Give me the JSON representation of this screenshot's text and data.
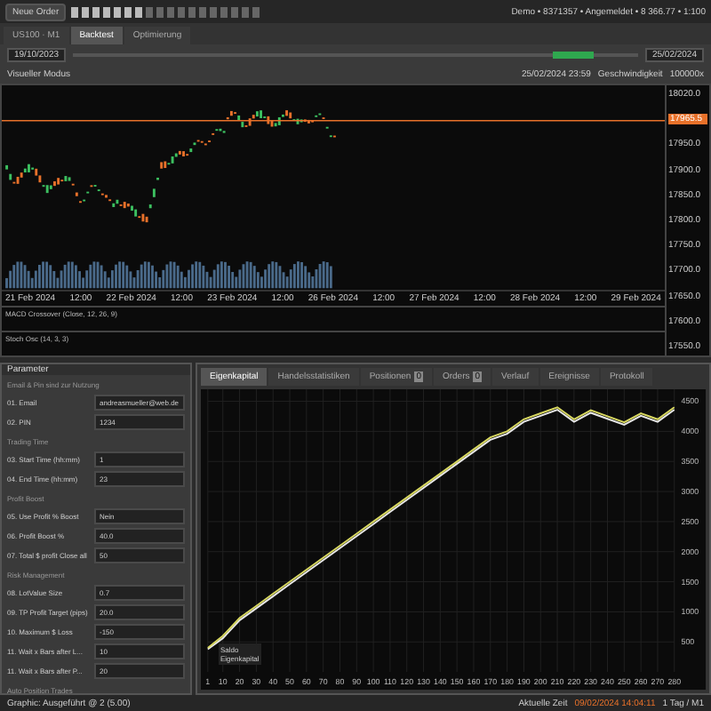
{
  "toolbar": {
    "new_order": "Neue Order",
    "account": "Demo • 8371357 • Angemeldet • 8 366.77 • 1:100"
  },
  "tabs": [
    {
      "label": "US100 · M1",
      "selected": false
    },
    {
      "label": "Backtest",
      "selected": true
    },
    {
      "label": "Optimierung",
      "selected": false
    }
  ],
  "range": {
    "start": "19/10/2023",
    "end": "25/02/2024",
    "level": 0.92
  },
  "visual_mode": {
    "label": "Visueller Modus",
    "time": "25/02/2024 23:59",
    "speed_label": "Geschwindigkeit",
    "speed": "100000x"
  },
  "chart": {
    "price_tag": "17965.5",
    "price_labels": [
      "18020.0",
      "17950.0",
      "17900.0",
      "17850.0",
      "17800.0",
      "17750.0",
      "17700.0",
      "17650.0",
      "17600.0",
      "17550.0"
    ],
    "time_labels": [
      "21 Feb 2024",
      "12:00",
      "22 Feb 2024",
      "12:00",
      "23 Feb 2024",
      "12:00",
      "26 Feb 2024",
      "12:00",
      "27 Feb 2024",
      "12:00",
      "28 Feb 2024",
      "12:00",
      "29 Feb 2024"
    ],
    "indicator_1": "MACD Crossover (Close, 12, 26, 9)",
    "indicator_2": "Stoch Osc (14, 3, 3)"
  },
  "parameters": {
    "title": "Parameter",
    "groups": [
      {
        "title": "Email & Pin sind zur Nutzung",
        "rows": [
          {
            "label": "01. Email",
            "value": "andreasmueller@web.de"
          },
          {
            "label": "02. PIN",
            "value": "1234"
          }
        ]
      },
      {
        "title": "Trading Time",
        "rows": [
          {
            "label": "03. Start Time (hh:mm)",
            "value": "1"
          },
          {
            "label": "04. End Time (hh:mm)",
            "value": "23"
          }
        ]
      },
      {
        "title": "Profit Boost",
        "rows": [
          {
            "label": "05. Use Profit % Boost",
            "value": "Nein"
          },
          {
            "label": "06. Profit Boost %",
            "value": "40.0"
          },
          {
            "label": "07. Total $ profit Close all",
            "value": "50"
          }
        ]
      },
      {
        "title": "Risk Management",
        "rows": [
          {
            "label": "08. LotValue Size",
            "value": "0.7"
          },
          {
            "label": "09. TP Profit Target (pips)",
            "value": "20.0"
          },
          {
            "label": "10. Maximum $ Loss",
            "value": "-150"
          },
          {
            "label": "11. Wait x Bars after L...",
            "value": "10"
          },
          {
            "label": "11. Wait x Bars after P...",
            "value": "20"
          }
        ]
      }
    ],
    "more": "Auto Position Trades"
  },
  "result_tabs": [
    {
      "label": "Eigenkapital",
      "selected": true
    },
    {
      "label": "Handelsstatistiken",
      "selected": false
    },
    {
      "label": "Positionen",
      "selected": false,
      "count": "0"
    },
    {
      "label": "Orders",
      "selected": false,
      "count": "0"
    },
    {
      "label": "Verlauf",
      "selected": false
    },
    {
      "label": "Ereignisse",
      "selected": false
    },
    {
      "label": "Protokoll",
      "selected": false
    }
  ],
  "equity": {
    "chart_data": {
      "type": "line",
      "x": [
        1,
        10,
        20,
        30,
        40,
        50,
        60,
        70,
        80,
        90,
        100,
        110,
        120,
        130,
        140,
        150,
        160,
        170,
        180,
        190,
        200,
        210,
        220,
        230,
        240,
        250,
        260,
        270,
        280
      ],
      "xticks": [
        1,
        10,
        20,
        30,
        40,
        50,
        60,
        70,
        80,
        90,
        100,
        110,
        120,
        130,
        140,
        150,
        160,
        170,
        180,
        190,
        200,
        210,
        220,
        230,
        240,
        250,
        260,
        270,
        280
      ],
      "yticks": [
        500,
        1000,
        1500,
        2000,
        2500,
        3000,
        3500,
        4000,
        4500
      ],
      "xlim": [
        1,
        280
      ],
      "ylim": [
        0,
        4700
      ],
      "grid": true,
      "series": [
        {
          "name": "Saldo",
          "color": "#e8e8e8",
          "values": [
            380,
            560,
            860,
            1060,
            1260,
            1460,
            1660,
            1860,
            2060,
            2260,
            2460,
            2660,
            2860,
            3060,
            3260,
            3460,
            3660,
            3860,
            3960,
            4160,
            4260,
            4360,
            4160,
            4310,
            4210,
            4110,
            4260,
            4160,
            4360
          ]
        },
        {
          "name": "Eigenkapital",
          "color": "#d8d860",
          "values": [
            400,
            600,
            900,
            1100,
            1300,
            1500,
            1700,
            1900,
            2100,
            2300,
            2500,
            2700,
            2900,
            3100,
            3300,
            3500,
            3700,
            3900,
            4000,
            4200,
            4300,
            4400,
            4200,
            4350,
            4250,
            4150,
            4300,
            4200,
            4400
          ]
        }
      ]
    }
  },
  "status": {
    "left": "Graphic: Ausgeführt @ 2 (5.00)",
    "time_label": "Aktuelle Zeit",
    "time": "09/02/2024 14:04:11",
    "zoom": "1 Tag / M1"
  }
}
